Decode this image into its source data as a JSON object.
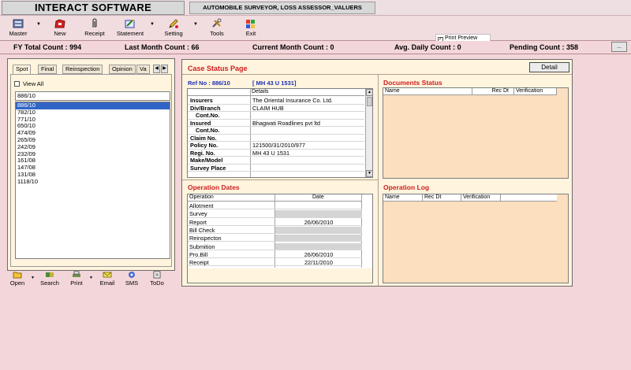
{
  "app": {
    "title": "INTERACT SOFTWARE",
    "subtitle": "AUTOMOBILE SURVEYOR, LOSS ASSESSOR_VALUERS"
  },
  "toolbar": {
    "master": "Master",
    "new": "New",
    "receipt": "Receipt",
    "statement": "Statement",
    "setting": "Setting",
    "tools": "Tools",
    "exit": "Exit",
    "print_preview": "Print Preview",
    "print_preview_checked": "✓"
  },
  "counts": {
    "fy_total": "FY Total Count : 994",
    "last_month": "Last Month Count : 66",
    "current_month": "Current Month Count : 0",
    "avg_daily": "Avg. Daily Count : 0",
    "pending": "Pending Count : 358",
    "more": "..."
  },
  "left": {
    "tabs": [
      "Spot",
      "Final",
      "Reinspection",
      "Opinion",
      "Va"
    ],
    "view_all": "View All",
    "search_value": "886/10",
    "refs": [
      "886/10",
      "782/10",
      "771/10",
      "650/10",
      "474/09",
      "265/09",
      "242/09",
      "232/09",
      "161/08",
      "147/08",
      "131/08",
      "1118/10"
    ],
    "selected_index": 0
  },
  "bottom": {
    "open": "Open",
    "search": "Search",
    "print": "Print",
    "email": "Email",
    "sms": "SMS",
    "todo": "ToDo"
  },
  "case": {
    "title": "Case Status Page",
    "detail_btn": "Detail",
    "ref_label": "Ref No : 886/10",
    "vehicle": "[ MH 43 U 1531]",
    "details_header": "Details",
    "details": [
      {
        "key": "Insurers",
        "value": "The Oriental Insurance Co. Ltd.",
        "indent": false
      },
      {
        "key": "Div/Branch",
        "value": "CLAIM HUB",
        "indent": false
      },
      {
        "key": "Cont.No.",
        "value": "",
        "indent": true
      },
      {
        "key": "Insured",
        "value": "Bhagwati Roadlines pvt ltd",
        "indent": false
      },
      {
        "key": "Cont.No.",
        "value": "",
        "indent": true
      },
      {
        "key": "Claim No.",
        "value": "",
        "indent": false
      },
      {
        "key": "Policy No.",
        "value": "121500/31/2010/977",
        "indent": false
      },
      {
        "key": "Regi. No.",
        "value": "MH 43 U 1531",
        "indent": false
      },
      {
        "key": "Make/Model",
        "value": "",
        "indent": false
      },
      {
        "key": "Survey Place",
        "value": "",
        "indent": false
      },
      {
        "key": "",
        "value": "",
        "indent": false
      }
    ]
  },
  "operation_dates": {
    "title": "Operation Dates",
    "col_operation": "Operation",
    "col_date": "Date",
    "rows": [
      {
        "op": "Allotment",
        "date": "",
        "shade": false
      },
      {
        "op": "Survey",
        "date": "",
        "shade": true
      },
      {
        "op": "Report",
        "date": "26/06/2010",
        "shade": false
      },
      {
        "op": "Bill Check",
        "date": "",
        "shade": true
      },
      {
        "op": "Reinspecton",
        "date": "",
        "shade": true
      },
      {
        "op": "Submition",
        "date": "",
        "shade": true
      },
      {
        "op": "Pro.Bill",
        "date": "26/06/2010",
        "shade": false
      },
      {
        "op": "Receipt",
        "date": "22/11/2010",
        "shade": false
      }
    ]
  },
  "documents": {
    "title": "Documents Status",
    "cols": [
      "Name",
      "Rec Dt",
      "Verification"
    ]
  },
  "oplog": {
    "title": "Operation Log",
    "cols": [
      "Name",
      "Rec Dt",
      "Verification"
    ]
  },
  "colors": {
    "background": "#f3d6d9",
    "panel": "#fff4dd",
    "accent_red": "#cc1f1f",
    "ref_blue": "#1b2fb8",
    "selection": "#3165c5",
    "grid_peach": "#fbdfbf"
  }
}
